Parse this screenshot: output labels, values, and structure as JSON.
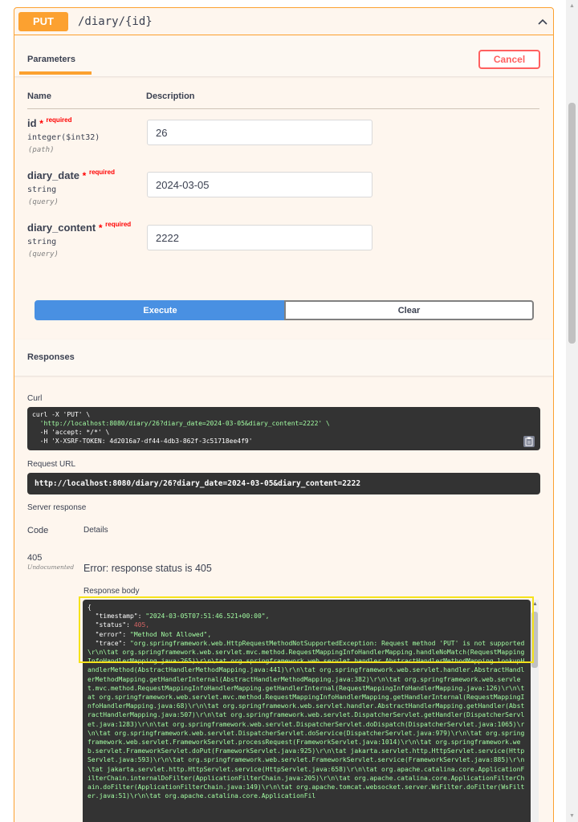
{
  "operation": {
    "method": "PUT",
    "path": "/diary/{id}"
  },
  "parameters_tab": {
    "label": "Parameters",
    "cancel_label": "Cancel"
  },
  "columns": {
    "name": "Name",
    "description": "Description"
  },
  "required_star": "*",
  "required_text": "required",
  "params": [
    {
      "name": "id",
      "type": "integer($int32)",
      "in": "(path)",
      "value": "26"
    },
    {
      "name": "diary_date",
      "type": "string",
      "in": "(query)",
      "value": "2024-03-05"
    },
    {
      "name": "diary_content",
      "type": "string",
      "in": "(query)",
      "value": "2222"
    }
  ],
  "buttons": {
    "execute": "Execute",
    "clear": "Clear"
  },
  "responses": {
    "title": "Responses",
    "curl_label": "Curl",
    "curl_lines": [
      "curl -X 'PUT' \\",
      "  'http://localhost:8080/diary/26?diary_date=2024-03-05&diary_content=2222' \\",
      "  -H 'accept: */*' \\",
      "  -H 'X-XSRF-TOKEN: 4d2016a7-df44-4db3-862f-3c51718ee4f9'"
    ],
    "request_url_label": "Request URL",
    "request_url": "http://localhost:8080/diary/26?diary_date=2024-03-05&diary_content=2222",
    "server_response_label": "Server response",
    "code_header": "Code",
    "details_header": "Details",
    "code": "405",
    "undocumented": "Undocumented",
    "error_text": "Error: response status is 405",
    "response_body_label": "Response body",
    "body_open": "{",
    "body_timestamp_key": "\"timestamp\": ",
    "body_timestamp_val": "\"2024-03-05T07:51:46.521+00:00\",",
    "body_status_key": "\"status\": ",
    "body_status_val": "405,",
    "body_error_key": "\"error\": ",
    "body_error_val": "\"Method Not Allowed\",",
    "body_trace_key": "\"trace\": ",
    "body_trace_val": "\"org.springframework.web.HttpRequestMethodNotSupportedException: Request method 'PUT' is not supported\\r\\n\\tat org.springframework.web.servlet.mvc.method.RequestMappingInfoHandlerMapping.handleNoMatch(RequestMappingInfoHandlerMapping.java:265)\\r\\n\\tat org.springframework.web.servlet.handler.AbstractHandlerMethodMapping.lookupHandlerMethod(AbstractHandlerMethodMapping.java:441)\\r\\n\\tat org.springframework.web.servlet.handler.AbstractHandlerMethodMapping.getHandlerInternal(AbstractHandlerMethodMapping.java:382)\\r\\n\\tat org.springframework.web.servlet.mvc.method.RequestMappingInfoHandlerMapping.getHandlerInternal(RequestMappingInfoHandlerMapping.java:126)\\r\\n\\tat org.springframework.web.servlet.mvc.method.RequestMappingInfoHandlerMapping.getHandlerInternal(RequestMappingInfoHandlerMapping.java:68)\\r\\n\\tat org.springframework.web.servlet.handler.AbstractHandlerMapping.getHandler(AbstractHandlerMapping.java:507)\\r\\n\\tat org.springframework.web.servlet.DispatcherServlet.getHandler(DispatcherServlet.java:1283)\\r\\n\\tat org.springframework.web.servlet.DispatcherServlet.doDispatch(DispatcherServlet.java:1065)\\r\\n\\tat org.springframework.web.servlet.DispatcherServlet.doService(DispatcherServlet.java:979)\\r\\n\\tat org.springframework.web.servlet.FrameworkServlet.processRequest(FrameworkServlet.java:1014)\\r\\n\\tat org.springframework.web.servlet.FrameworkServlet.doPut(FrameworkServlet.java:925)\\r\\n\\tat jakarta.servlet.http.HttpServlet.service(HttpServlet.java:593)\\r\\n\\tat org.springframework.web.servlet.FrameworkServlet.service(FrameworkServlet.java:885)\\r\\n\\tat jakarta.servlet.http.HttpServlet.service(HttpServlet.java:658)\\r\\n\\tat org.apache.catalina.core.ApplicationFilterChain.internalDoFilter(ApplicationFilterChain.java:205)\\r\\n\\tat org.apache.catalina.core.ApplicationFilterChain.doFilter(ApplicationFilterChain.java:149)\\r\\n\\tat org.apache.tomcat.websocket.server.WsFilter.doFilter(WsFilter.java:51)\\r\\n\\tat org.apache.catalina.core.ApplicationFil"
  },
  "colors": {
    "put_accent": "#fca130",
    "execute_blue": "#4990e2",
    "cancel_red": "#ff6060",
    "highlight": "#f5e21a"
  },
  "icons": {
    "collapse": "chevron-up-icon",
    "copy": "clipboard-icon"
  }
}
